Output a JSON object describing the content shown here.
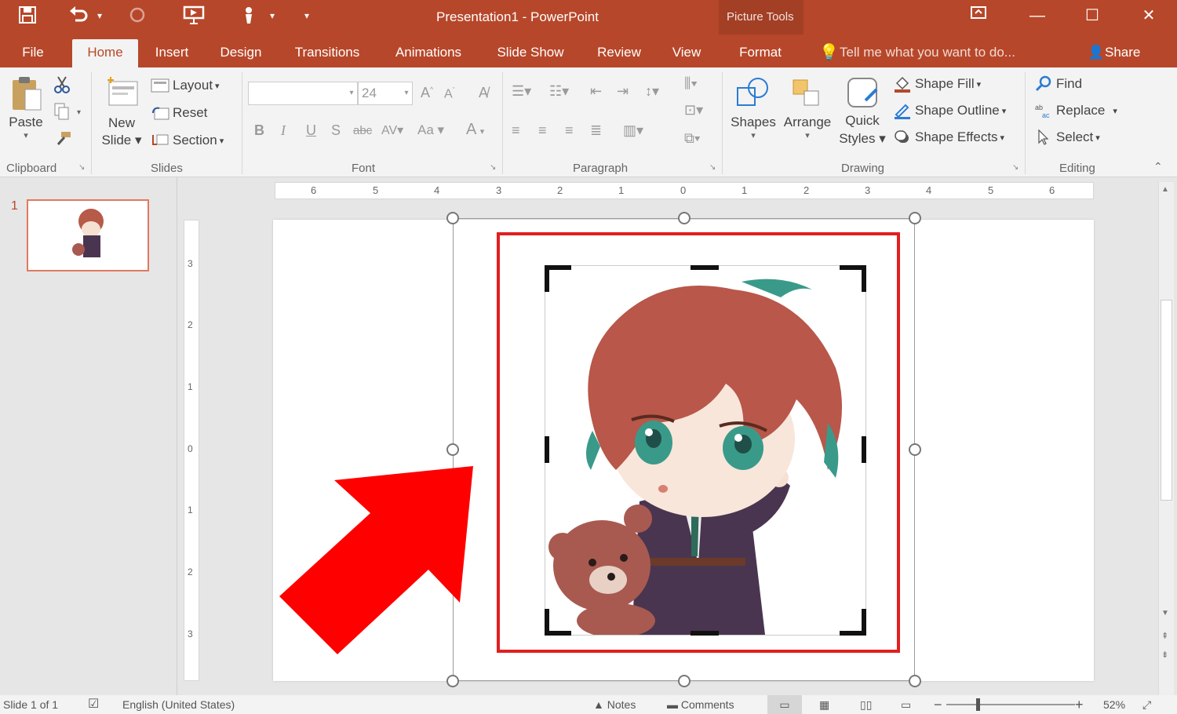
{
  "window": {
    "title": "Presentation1 - PowerPoint",
    "context_tab_group": "Picture Tools",
    "share_label": "Share",
    "tell_me_placeholder": "Tell me what you want to do..."
  },
  "tabs": [
    {
      "label": "File"
    },
    {
      "label": "Home"
    },
    {
      "label": "Insert"
    },
    {
      "label": "Design"
    },
    {
      "label": "Transitions"
    },
    {
      "label": "Animations"
    },
    {
      "label": "Slide Show"
    },
    {
      "label": "Review"
    },
    {
      "label": "View"
    },
    {
      "label": "Format"
    }
  ],
  "ribbon": {
    "clipboard": {
      "paste": "Paste",
      "group": "Clipboard"
    },
    "slides": {
      "new_slide_1": "New",
      "new_slide_2": "Slide",
      "layout": "Layout",
      "reset": "Reset",
      "section": "Section",
      "group": "Slides"
    },
    "font": {
      "font_size": "24",
      "change_case": "Aa",
      "group": "Font"
    },
    "paragraph": {
      "group": "Paragraph"
    },
    "drawing": {
      "shapes": "Shapes",
      "arrange": "Arrange",
      "quick_1": "Quick",
      "quick_2": "Styles",
      "shape_fill": "Shape Fill",
      "shape_outline": "Shape Outline",
      "shape_effects": "Shape Effects",
      "group": "Drawing"
    },
    "editing": {
      "find": "Find",
      "replace": "Replace",
      "select": "Select",
      "group": "Editing"
    }
  },
  "thumbnails": [
    {
      "number": "1"
    }
  ],
  "ruler": {
    "h_ticks": [
      "6",
      "5",
      "4",
      "3",
      "2",
      "1",
      "0",
      "1",
      "2",
      "3",
      "4",
      "5",
      "6"
    ],
    "v_ticks": [
      "3",
      "2",
      "1",
      "0",
      "1",
      "2",
      "3"
    ]
  },
  "status": {
    "slide_info": "Slide 1 of 1",
    "language": "English (United States)",
    "notes": "Notes",
    "comments": "Comments",
    "zoom": "52%"
  },
  "colors": {
    "accent": "#b7472a",
    "highlight": "#e02020",
    "arrow": "#ff0000"
  }
}
